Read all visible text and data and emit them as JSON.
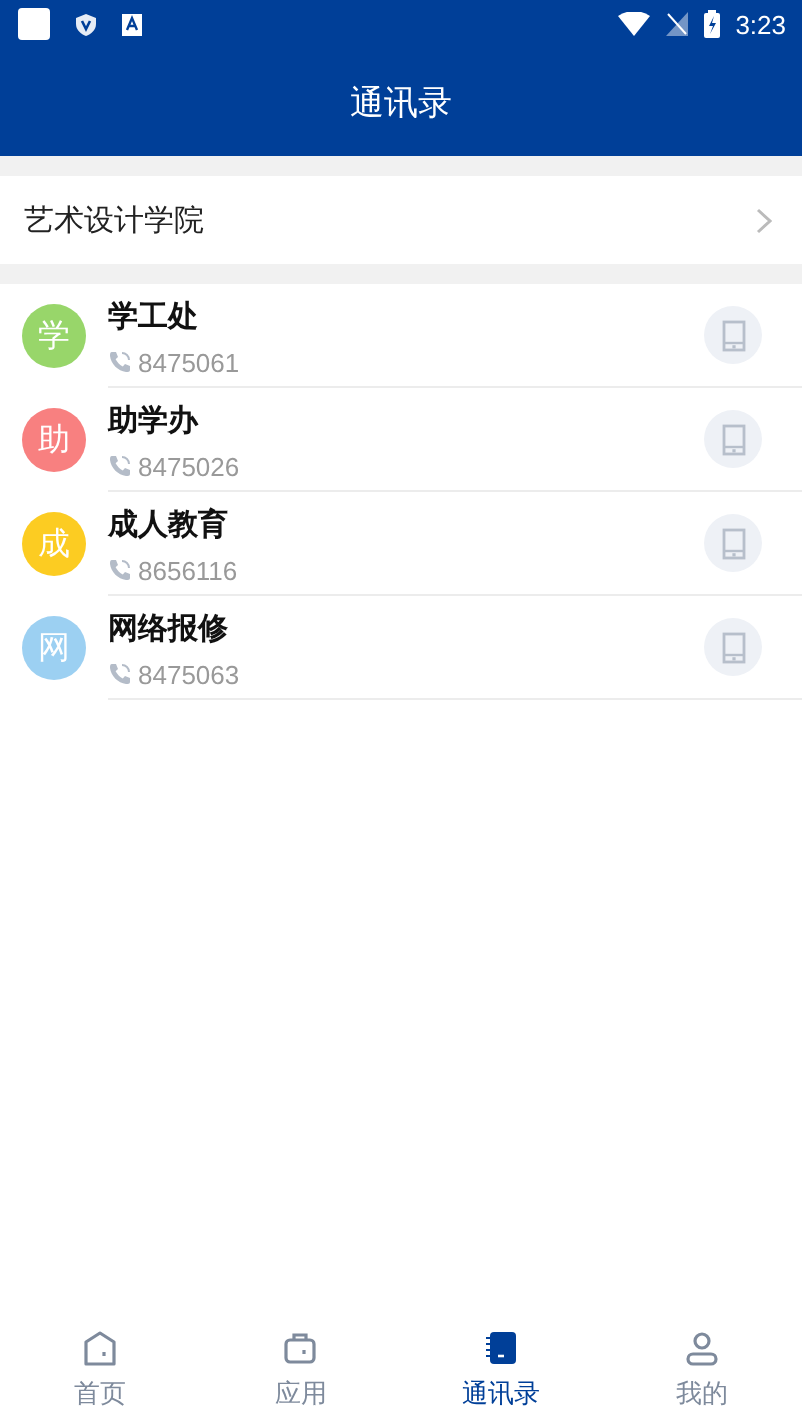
{
  "status_bar": {
    "time": "3:23"
  },
  "header": {
    "title": "通讯录"
  },
  "group": {
    "label": "艺术设计学院"
  },
  "contacts": [
    {
      "avatar": "学",
      "name": "学工处",
      "phone": "8475061",
      "color": "#98d66a"
    },
    {
      "avatar": "助",
      "name": "助学办",
      "phone": "8475026",
      "color": "#f88080"
    },
    {
      "avatar": "成",
      "name": "成人教育",
      "phone": "8656116",
      "color": "#fccc22"
    },
    {
      "avatar": "网",
      "name": "网络报修",
      "phone": "8475063",
      "color": "#9cd0f2"
    }
  ],
  "tabs": [
    {
      "label": "首页",
      "selected": false
    },
    {
      "label": "应用",
      "selected": false
    },
    {
      "label": "通讯录",
      "selected": true
    },
    {
      "label": "我的",
      "selected": false
    }
  ]
}
